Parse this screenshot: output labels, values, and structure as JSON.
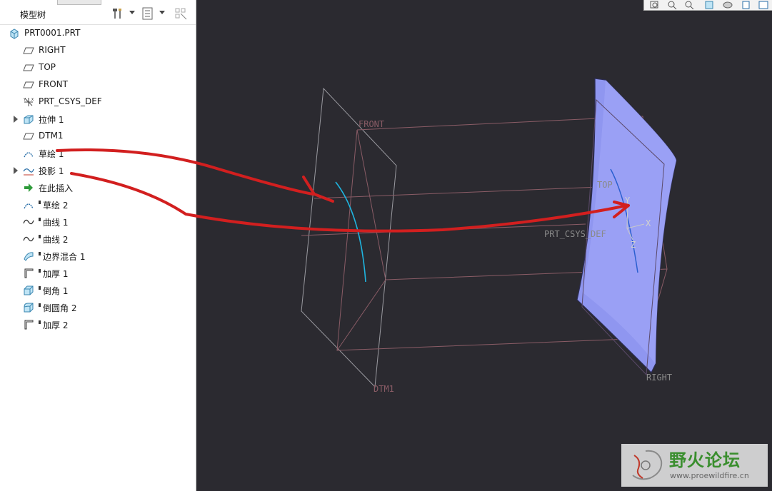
{
  "sidebar": {
    "title": "模型树",
    "items": [
      {
        "label": "PRT0001.PRT",
        "icon": "part-icon",
        "expandable": false
      },
      {
        "label": "RIGHT",
        "icon": "datum-plane-icon",
        "expandable": false
      },
      {
        "label": "TOP",
        "icon": "datum-plane-icon",
        "expandable": false
      },
      {
        "label": "FRONT",
        "icon": "datum-plane-icon",
        "expandable": false
      },
      {
        "label": "PRT_CSYS_DEF",
        "icon": "csys-icon",
        "expandable": false
      },
      {
        "label": "拉伸 1",
        "icon": "extrude-icon",
        "expandable": true
      },
      {
        "label": "DTM1",
        "icon": "datum-plane-icon",
        "expandable": false
      },
      {
        "label": "草绘 1",
        "icon": "sketch-icon",
        "expandable": false
      },
      {
        "label": "投影 1",
        "icon": "projection-icon",
        "expandable": true
      },
      {
        "label": "在此插入",
        "icon": "insert-here-icon",
        "expandable": false
      },
      {
        "label": "草绘 2",
        "icon": "sketch-icon",
        "expandable": false
      },
      {
        "label": "曲线 1",
        "icon": "curve-icon",
        "expandable": false
      },
      {
        "label": "曲线 2",
        "icon": "curve-icon",
        "expandable": false
      },
      {
        "label": "边界混合 1",
        "icon": "boundary-blend-icon",
        "expandable": false
      },
      {
        "label": "加厚 1",
        "icon": "thicken-icon",
        "expandable": false
      },
      {
        "label": "倒角 1",
        "icon": "chamfer-icon",
        "expandable": false
      },
      {
        "label": "倒圆角 2",
        "icon": "round-icon",
        "expandable": false
      },
      {
        "label": "加厚 2",
        "icon": "thicken-icon",
        "expandable": false
      }
    ]
  },
  "viewport": {
    "labels": {
      "front": "FRONT",
      "top": "TOP",
      "csys": "PRT_CSYS_DEF",
      "dtm1": "DTM1",
      "right": "RIGHT",
      "axis_x": "X",
      "axis_y": "Y",
      "axis_z": "Z"
    }
  },
  "watermark": {
    "title": "野火论坛",
    "url": "www.proewildfire.cn"
  },
  "colors": {
    "background": "#2b2a30",
    "datum_plane": "#b08080",
    "surface": "#8f96f0",
    "curve": "#1fb5e0",
    "annotation_arrow": "#d21f1f"
  }
}
